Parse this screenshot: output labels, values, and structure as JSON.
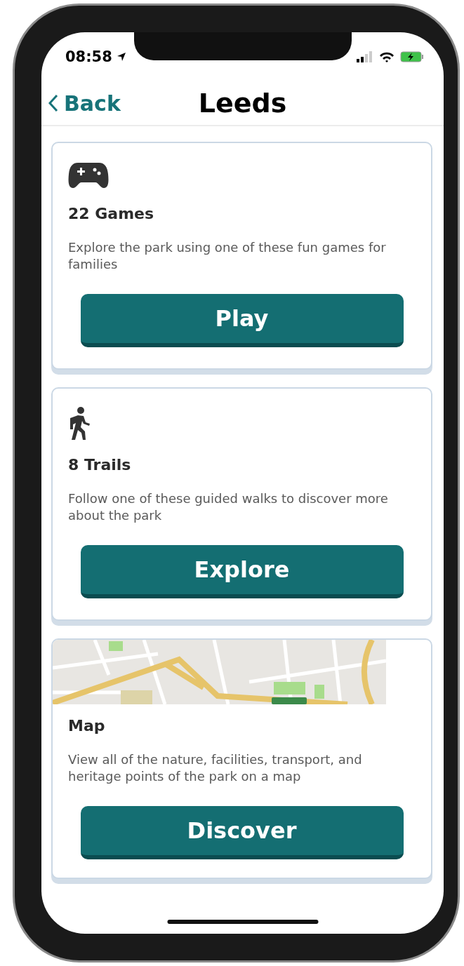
{
  "status_bar": {
    "time": "08:58"
  },
  "nav": {
    "back_label": "Back",
    "title": "Leeds"
  },
  "cards": [
    {
      "kind": "games",
      "title": "22 Games",
      "description": "Explore the park using one of these fun games for families",
      "button": "Play"
    },
    {
      "kind": "trails",
      "title": "8 Trails",
      "description": "Follow one of these guided walks to discover more about the park",
      "button": "Explore"
    },
    {
      "kind": "map",
      "title": "Map",
      "description": "View all of the nature, facilities, transport, and heritage points of the park on a map",
      "button": "Discover"
    }
  ]
}
